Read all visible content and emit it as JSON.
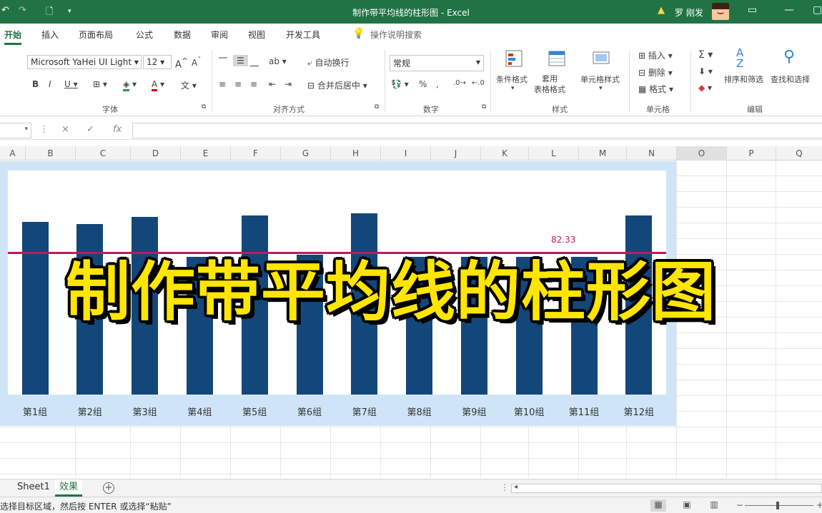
{
  "window": {
    "title": "制作带平均线的柱形图 - Excel",
    "user_name": "罗 刚发",
    "qa_icons": [
      "undo-icon",
      "redo-icon",
      "print-preview-icon",
      "customize-qa-icon"
    ]
  },
  "menu": {
    "tabs": [
      "开始",
      "插入",
      "页面布局",
      "公式",
      "数据",
      "审阅",
      "视图",
      "开发工具"
    ],
    "active_tab": "开始",
    "tell_me": "操作说明搜索"
  },
  "ribbon": {
    "font": {
      "name": "Microsoft YaHei UI Light",
      "size": "12",
      "group_label": "字体"
    },
    "alignment": {
      "wrap_text": "自动换行",
      "merge_center": "合并后居中",
      "group_label": "对齐方式"
    },
    "number": {
      "format": "常规",
      "percent": "%",
      "group_label": "数字"
    },
    "styles": {
      "conditional": "条件格式",
      "table_format": "套用\n表格格式",
      "cell_styles": "单元格样式",
      "group_label": "样式"
    },
    "cells": {
      "insert": "插入",
      "delete": "删除",
      "format": "格式",
      "group_label": "单元格"
    },
    "editing": {
      "sort_filter": "排序和筛选",
      "find_select": "查找和选择",
      "group_label": "编辑"
    }
  },
  "formula_bar": {
    "fx": "fx",
    "cancel": "×",
    "enter": "✓"
  },
  "columns": [
    "A",
    "B",
    "C",
    "D",
    "E",
    "F",
    "G",
    "H",
    "I",
    "J",
    "K",
    "L",
    "M",
    "N",
    "O",
    "P",
    "Q"
  ],
  "selected_column": "O",
  "chart_data": {
    "type": "bar",
    "categories": [
      "第1组",
      "第2组",
      "第3组",
      "第4组",
      "第5组",
      "第6组",
      "第7组",
      "第8组",
      "第9组",
      "第10组",
      "第11组",
      "第12组"
    ],
    "values": [
      100,
      99,
      103,
      80,
      104,
      81,
      105,
      80,
      80,
      80,
      80,
      104
    ],
    "average": 82.33,
    "average_label": "82.33",
    "ylim": [
      0,
      130
    ],
    "colors": {
      "bar": "#13477a",
      "average_line": "#c2185b",
      "chart_background": "#cfe5f7"
    }
  },
  "overlay_title": "制作带平均线的柱形图",
  "sheets": {
    "tabs": [
      "Sheet1",
      "效果"
    ],
    "active": "效果"
  },
  "status": {
    "message": "选择目标区域，然后按 ENTER 或选择“粘贴”"
  }
}
